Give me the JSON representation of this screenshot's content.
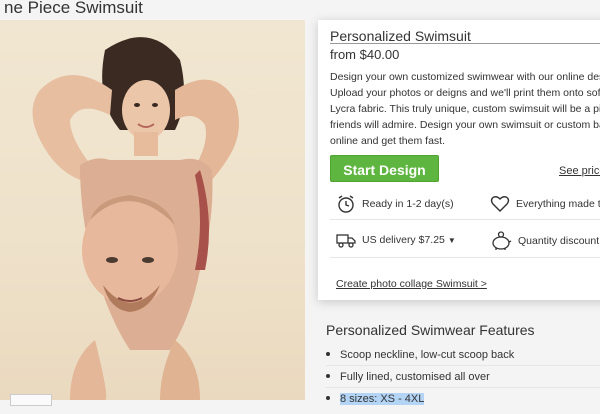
{
  "page": {
    "title": "ne Piece Swimsuit"
  },
  "product": {
    "name": "Personalized Swimsuit",
    "price": "from $40.00",
    "description_lines": [
      "Design your own customized swimwear with our online des",
      "Upload your photos or deigns and we'll print them onto soft",
      "Lycra fabric. This truly unique, custom swimsuit will be a pi",
      "friends will admire. Design your own swimsuit or custom ba",
      "online and get them fast."
    ],
    "start_button": "Start Design",
    "see_price": "See price",
    "features": {
      "ready": "Ready in 1-2 day(s)",
      "everything": "Everything made to",
      "delivery": "US delivery $7.25",
      "delivery_caret": "▼",
      "quantity": "Quantity discount"
    },
    "collage_link": "Create photo collage Swimsuit >"
  },
  "features_section": {
    "title": "Personalized Swimwear Features",
    "items": [
      "Scoop neckline, low-cut scoop back",
      "Fully lined, customised all over",
      "8 sizes: XS - 4XL"
    ]
  },
  "colors": {
    "accent_green": "#5eb53f",
    "selection_blue": "#b3d4f5"
  },
  "icons": [
    "alarm-clock-icon",
    "heart-icon",
    "truck-icon",
    "piggy-bank-icon"
  ]
}
